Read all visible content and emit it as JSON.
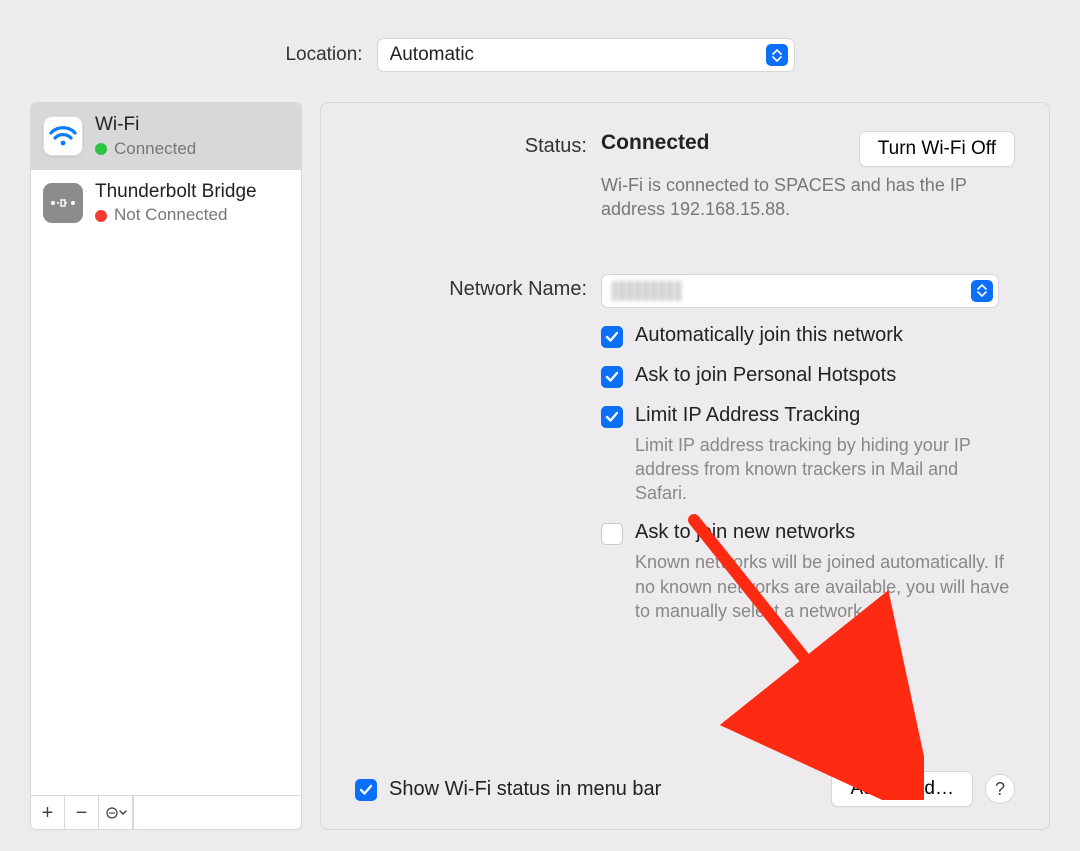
{
  "location": {
    "label": "Location:",
    "value": "Automatic"
  },
  "sidebar": {
    "items": [
      {
        "name": "Wi-Fi",
        "status": "Connected",
        "dot": "green",
        "iconType": "wifi",
        "selected": true
      },
      {
        "name": "Thunderbolt Bridge",
        "status": "Not Connected",
        "dot": "red",
        "iconType": "tb",
        "selected": false
      }
    ]
  },
  "panel": {
    "statusLabel": "Status:",
    "statusValue": "Connected",
    "turnOffLabel": "Turn Wi-Fi Off",
    "statusDesc": "Wi-Fi is connected to SPACES and has the IP address 192.168.15.88.",
    "networkNameLabel": "Network Name:",
    "checks": {
      "autoJoin": {
        "label": "Automatically join this network",
        "checked": true
      },
      "askHotspots": {
        "label": "Ask to join Personal Hotspots",
        "checked": true
      },
      "limitIP": {
        "label": "Limit IP Address Tracking",
        "checked": true,
        "desc": "Limit IP address tracking by hiding your IP address from known trackers in Mail and Safari."
      },
      "askNew": {
        "label": "Ask to join new networks",
        "checked": false,
        "desc": "Known networks will be joined automatically. If no known networks are available, you will have to manually select a network."
      }
    },
    "showMenuBar": {
      "label": "Show Wi-Fi status in menu bar",
      "checked": true
    },
    "advancedLabel": "Advanced…",
    "helpLabel": "?"
  }
}
